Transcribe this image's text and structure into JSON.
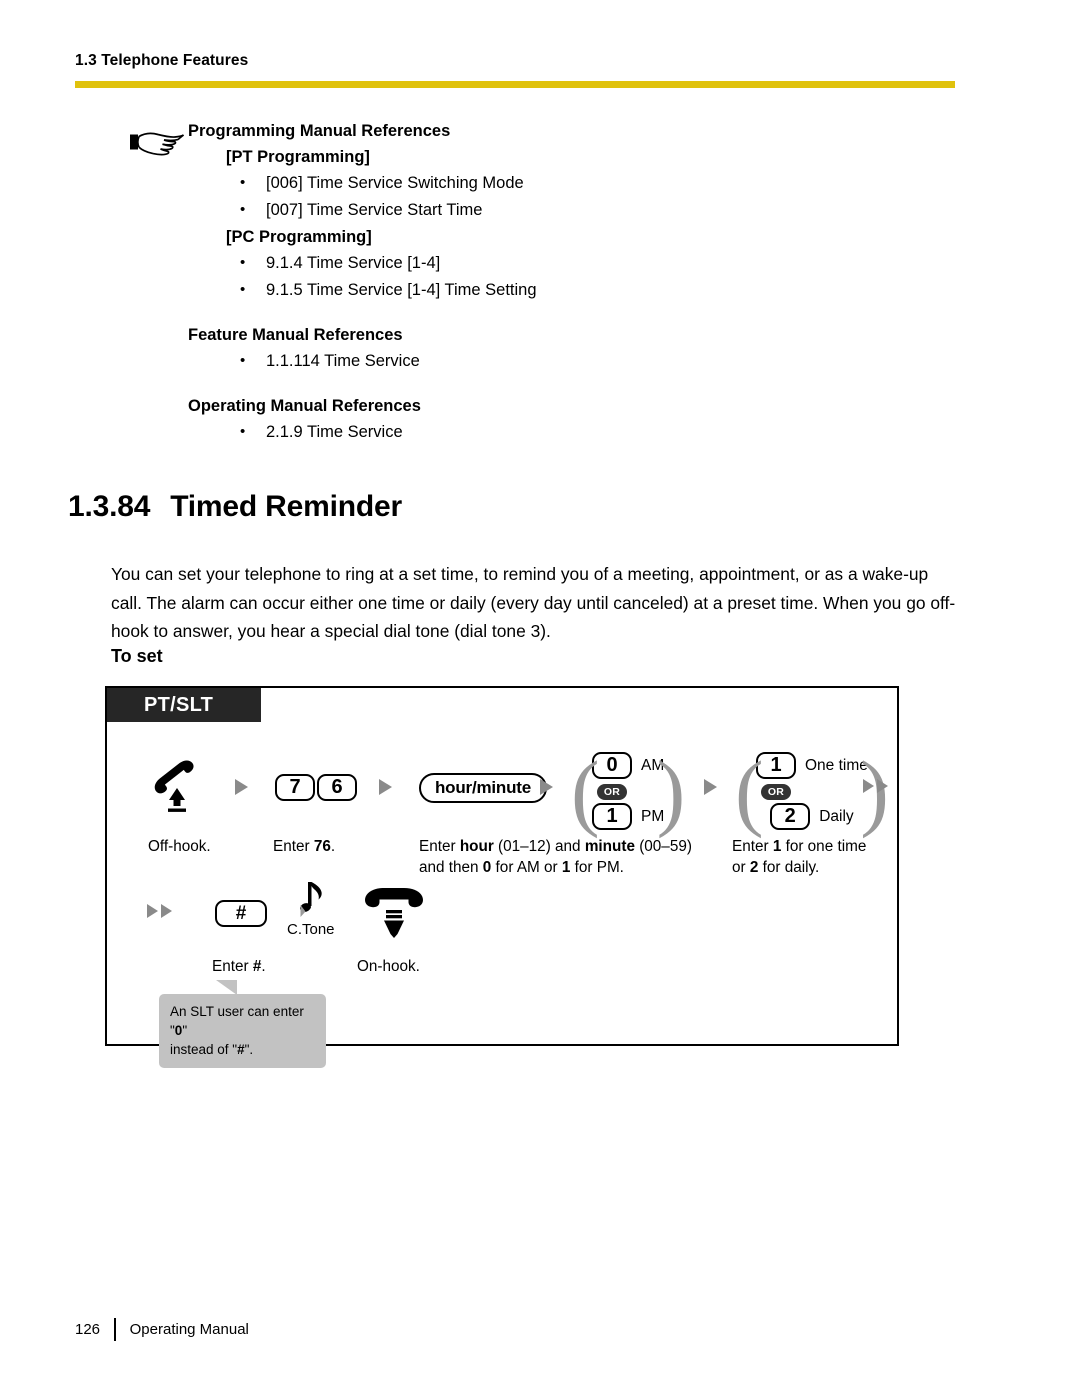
{
  "header": {
    "running_head": "1.3 Telephone Features",
    "rule_color": "#E0C20D"
  },
  "references": {
    "hand_icon": "pointing-hand-icon",
    "programming_title": "Programming Manual References",
    "pt_heading": "[PT Programming]",
    "pt_items": [
      "[006] Time Service Switching Mode",
      "[007] Time Service Start Time"
    ],
    "pc_heading": "[PC Programming]",
    "pc_items": [
      "9.1.4 Time Service [1-4]",
      "9.1.5 Time Service [1-4] Time Setting"
    ],
    "feature_title": "Feature Manual References",
    "feature_items": [
      "1.1.114 Time Service"
    ],
    "operating_title": "Operating Manual References",
    "operating_items": [
      "2.1.9 Time Service"
    ]
  },
  "section": {
    "number": "1.3.84",
    "title": "Timed Reminder",
    "paragraph": "You can set your telephone to ring at a set time, to remind you of a meeting, appointment, or as a wake-up call. The alarm can occur either one time or daily (every day until canceled) at a preset time. When you go off-hook to answer, you hear a special dial tone (dial tone 3).",
    "to_set_label": "To set"
  },
  "diagram": {
    "tag": "PT/SLT",
    "row1": {
      "step1_icon": "offhook-handset-icon",
      "step2_keys": [
        "7",
        "6"
      ],
      "step3_key": "hour/minute",
      "step4": {
        "option_a_key": "0",
        "option_a_label": "AM",
        "or": "OR",
        "option_b_key": "1",
        "option_b_label": "PM"
      },
      "step5": {
        "option_a_key": "1",
        "option_a_label": "One time",
        "or": "OR",
        "option_b_key": "2",
        "option_b_label": "Daily"
      }
    },
    "captions1": {
      "c1": "Off-hook.",
      "c2_pre": "Enter ",
      "c2_bold": "76",
      "c2_post": ".",
      "c3_line1_a": "Enter ",
      "c3_line1_b": "hour",
      "c3_line1_c": " (01–12) and ",
      "c3_line1_d": "minute",
      "c3_line1_e": " (00–59)",
      "c3_line2_a": "and then ",
      "c3_line2_b": "0",
      "c3_line2_c": " for AM or ",
      "c3_line2_d": "1",
      "c3_line2_e": " for PM.",
      "c4_line1_a": "Enter ",
      "c4_line1_b": "1",
      "c4_line1_c": " for one time",
      "c4_line2_a": "or ",
      "c4_line2_b": "2",
      "c4_line2_c": " for daily."
    },
    "row2": {
      "hash_key": "#",
      "ctone_icon": "music-note-icon",
      "ctone_label": "C.Tone",
      "onhook_icon": "onhook-handset-icon",
      "caption_hash_pre": "Enter ",
      "caption_hash_bold": "#",
      "caption_hash_post": ".",
      "caption_onhook": "On-hook."
    },
    "callout": {
      "line1_a": "An SLT user can enter \"",
      "line1_b": "0",
      "line1_c": "\"",
      "line2_a": "instead of \"",
      "line2_b": "#",
      "line2_c": "\".",
      "bg_color": "#c2c2c2"
    }
  },
  "footer": {
    "page_number": "126",
    "manual_name": "Operating Manual"
  }
}
